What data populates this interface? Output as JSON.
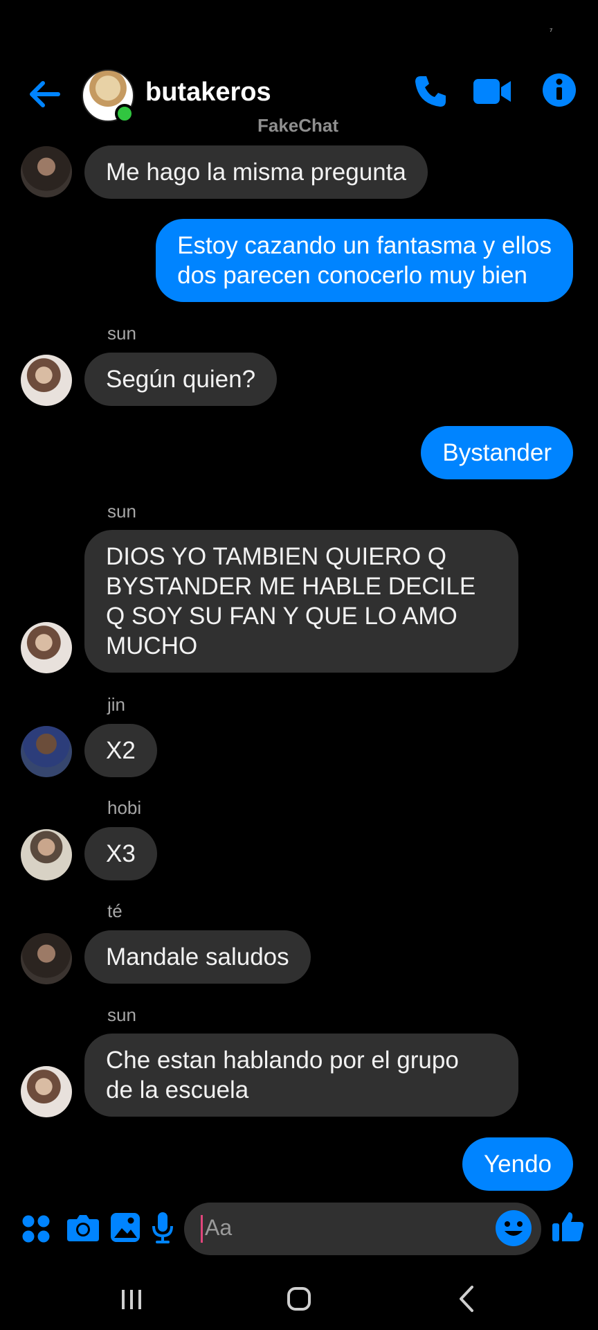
{
  "status_bar": {
    "glyph": "⁷"
  },
  "header": {
    "title": "butakeros",
    "watermark": "FakeChat",
    "back_icon": "back-arrow-icon",
    "call_icon": "phone-icon",
    "video_icon": "video-camera-icon",
    "info_icon": "info-icon",
    "accent_color": "#0084ff",
    "online_color": "#31c640"
  },
  "messages": [
    {
      "direction": "in",
      "sender": "",
      "text": "Me hago la misma pregunta"
    },
    {
      "direction": "out",
      "text": "Estoy cazando un fantasma y ellos\ndos parecen conocerlo muy bien"
    },
    {
      "direction": "in",
      "sender": "sun",
      "text": "Según quien?"
    },
    {
      "direction": "out",
      "text": "Bystander"
    },
    {
      "direction": "in",
      "sender": "sun",
      "text": "DIOS YO TAMBIEN QUIERO Q\nBYSTANDER ME HABLE DECILE\nQ SOY SU FAN Y QUE LO AMO\nMUCHO"
    },
    {
      "direction": "in",
      "sender": "jin",
      "text": "X2"
    },
    {
      "direction": "in",
      "sender": "hobi",
      "text": "X3"
    },
    {
      "direction": "in",
      "sender": "té",
      "text": "Mandale saludos"
    },
    {
      "direction": "in",
      "sender": "sun",
      "text": "Che estan hablando por el grupo\nde la escuela"
    },
    {
      "direction": "out",
      "text": "Yendo"
    }
  ],
  "composer": {
    "placeholder": "Aa",
    "icons": [
      "apps-grid-icon",
      "camera-icon",
      "gallery-icon",
      "microphone-icon",
      "emoji-icon",
      "thumbs-up-icon"
    ]
  },
  "navbar": {
    "icons": [
      "recents-icon",
      "home-icon",
      "back-icon"
    ]
  }
}
